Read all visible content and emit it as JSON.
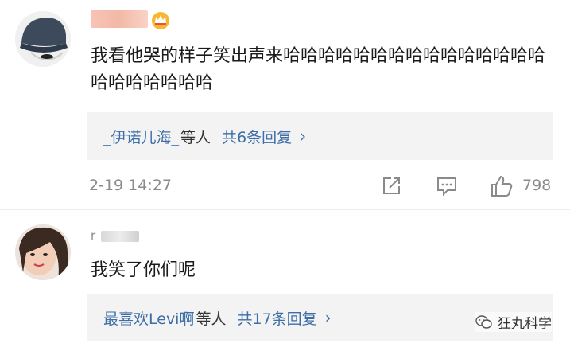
{
  "comments": [
    {
      "username": "•••",
      "text": "我看他哭的样子笑出声来哈哈哈哈哈哈哈哈哈哈哈哈哈哈哈哈哈哈哈哈哈哈",
      "reply_summary": {
        "names": "_伊诺儿海_",
        "suffix": "等人",
        "count": "共6条回复",
        "chevron": "›"
      },
      "timestamp": "2-19 14:27",
      "likes": "798",
      "icons": [
        "share-icon",
        "comment-icon",
        "like-icon"
      ]
    },
    {
      "username": "r",
      "text": "我笑了你们呢",
      "reply_summary": {
        "names": "最喜欢Levi啊",
        "suffix": "等人",
        "count": "共17条回复",
        "chevron": "›"
      }
    }
  ],
  "watermark": {
    "text": "狂丸科学",
    "icon": "wechat-icon"
  },
  "colors": {
    "link": "#3d6ea8",
    "meta": "#8a8a8a",
    "reply_bg": "#f3f3f3"
  }
}
